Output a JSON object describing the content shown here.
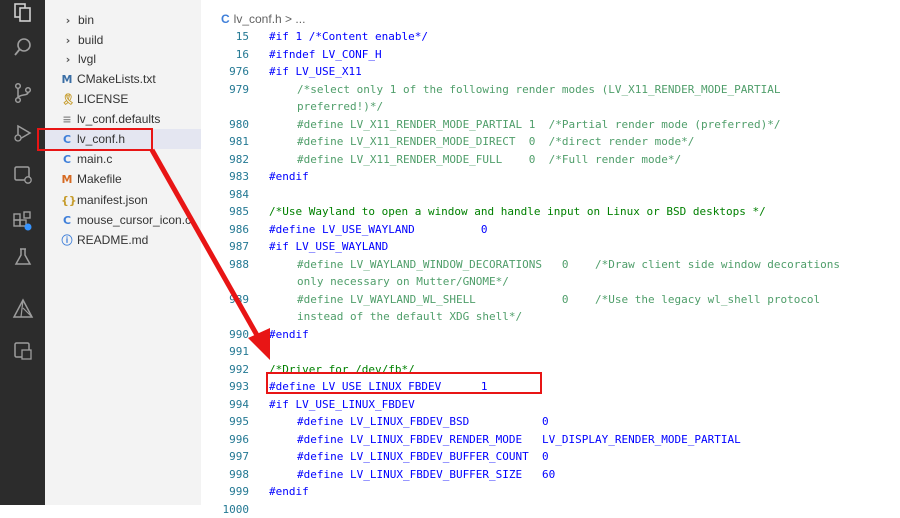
{
  "explorer": {
    "items": [
      {
        "label": "bin",
        "icon": "chevron-right-icon",
        "glyph": "›",
        "color": "#555555"
      },
      {
        "label": "build",
        "icon": "chevron-right-icon",
        "glyph": "›",
        "color": "#555555"
      },
      {
        "label": "lvgl",
        "icon": "chevron-right-icon",
        "glyph": "›",
        "color": "#555555"
      },
      {
        "label": "CMakeLists.txt",
        "icon": "cmake-file-icon",
        "glyph": "M",
        "color": "#3a6ea5"
      },
      {
        "label": "LICENSE",
        "icon": "license-file-icon",
        "glyph": "🎗",
        "color": "#c69c2c"
      },
      {
        "label": "lv_conf.defaults",
        "icon": "text-file-icon",
        "glyph": "≡",
        "color": "#8a8a8a"
      },
      {
        "label": "lv_conf.h",
        "icon": "c-header-file-icon",
        "glyph": "C",
        "color": "#3f7fd9"
      },
      {
        "label": "main.c",
        "icon": "c-file-icon",
        "glyph": "C",
        "color": "#3f7fd9"
      },
      {
        "label": "Makefile",
        "icon": "makefile-icon",
        "glyph": "M",
        "color": "#d66a22"
      },
      {
        "label": "manifest.json",
        "icon": "json-file-icon",
        "glyph": "{}",
        "color": "#c69c2c"
      },
      {
        "label": "mouse_cursor_icon.c",
        "icon": "c-file-icon",
        "glyph": "C",
        "color": "#3f7fd9"
      },
      {
        "label": "README.md",
        "icon": "info-icon",
        "glyph": "ⓘ",
        "color": "#3f7fd9"
      }
    ]
  },
  "breadcrumb": {
    "icon": "C",
    "file": "lv_conf.h",
    "sep": ">",
    "rest": "..."
  },
  "code_lines": [
    {
      "n": "15",
      "state": "active",
      "text": "#if 1 /*Content enable*/"
    },
    {
      "n": "16",
      "state": "active",
      "text": "#ifndef LV_CONF_H"
    },
    {
      "n": "976",
      "state": "active",
      "text": "#if LV_USE_X11"
    },
    {
      "n": "979",
      "state": "inactive",
      "indent": 1,
      "text": "/*select only 1 of the following render modes (LV_X11_RENDER_MODE_PARTIAL"
    },
    {
      "n": "",
      "state": "inactive",
      "indent": 1,
      "text": "preferred!)*/"
    },
    {
      "n": "980",
      "state": "inactive",
      "indent": 1,
      "text": "#define LV_X11_RENDER_MODE_PARTIAL 1  /*Partial render mode (preferred)*/"
    },
    {
      "n": "981",
      "state": "inactive",
      "indent": 1,
      "text": "#define LV_X11_RENDER_MODE_DIRECT  0  /*direct render mode*/"
    },
    {
      "n": "982",
      "state": "inactive",
      "indent": 1,
      "text": "#define LV_X11_RENDER_MODE_FULL    0  /*Full render mode*/"
    },
    {
      "n": "983",
      "state": "active",
      "text": "#endif"
    },
    {
      "n": "984",
      "state": "active",
      "text": ""
    },
    {
      "n": "985",
      "state": "active",
      "text": "/*Use Wayland to open a window and handle input on Linux or BSD desktops */"
    },
    {
      "n": "986",
      "state": "active",
      "text": "#define LV_USE_WAYLAND          0"
    },
    {
      "n": "987",
      "state": "active",
      "text": "#if LV_USE_WAYLAND"
    },
    {
      "n": "988",
      "state": "inactive",
      "indent": 1,
      "text": "#define LV_WAYLAND_WINDOW_DECORATIONS   0    /*Draw client side window decorations"
    },
    {
      "n": "",
      "state": "inactive",
      "indent": 1,
      "text": "only necessary on Mutter/GNOME*/"
    },
    {
      "n": "989",
      "state": "inactive",
      "indent": 1,
      "text": "#define LV_WAYLAND_WL_SHELL             0    /*Use the legacy wl_shell protocol"
    },
    {
      "n": "",
      "state": "inactive",
      "indent": 1,
      "text": "instead of the default XDG shell*/"
    },
    {
      "n": "990",
      "state": "active",
      "text": "#endif"
    },
    {
      "n": "991",
      "state": "active",
      "text": ""
    },
    {
      "n": "992",
      "state": "active",
      "text": "/*Driver for /dev/fb*/"
    },
    {
      "n": "993",
      "state": "active",
      "text": "#define LV_USE_LINUX_FBDEV      1"
    },
    {
      "n": "994",
      "state": "active",
      "text": "#if LV_USE_LINUX_FBDEV"
    },
    {
      "n": "995",
      "state": "active",
      "indent": 1,
      "text": "#define LV_LINUX_FBDEV_BSD           0"
    },
    {
      "n": "996",
      "state": "active",
      "indent": 1,
      "text": "#define LV_LINUX_FBDEV_RENDER_MODE   LV_DISPLAY_RENDER_MODE_PARTIAL"
    },
    {
      "n": "997",
      "state": "active",
      "indent": 1,
      "text": "#define LV_LINUX_FBDEV_BUFFER_COUNT  0"
    },
    {
      "n": "998",
      "state": "active",
      "indent": 1,
      "text": "#define LV_LINUX_FBDEV_BUFFER_SIZE   60"
    },
    {
      "n": "999",
      "state": "active",
      "text": "#endif"
    },
    {
      "n": "1000",
      "state": "active",
      "text": ""
    }
  ],
  "activity_icons": [
    "explorer-icon",
    "search-icon",
    "source-control-icon",
    "run-debug-icon",
    "remote-explorer-icon",
    "extensions-icon",
    "testing-icon",
    "cmake-icon",
    "container-icon"
  ],
  "annotation_color": "#e81515"
}
